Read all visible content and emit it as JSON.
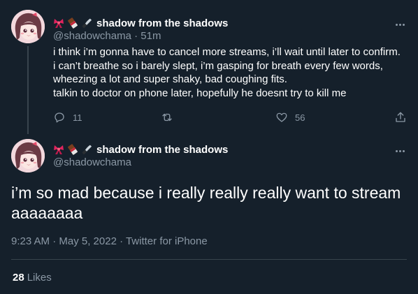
{
  "colors": {
    "background": "#15202b",
    "text_primary": "#ffffff",
    "text_secondary": "#8b98a5",
    "divider": "#38444d"
  },
  "reply_tweet": {
    "author": {
      "display_name": "shadow from the shadows",
      "name_emojis": [
        "ribbon-icon",
        "chocolate-bar-icon",
        "kitchen-knife-icon"
      ],
      "handle": "@shadowchama",
      "time": "· 51m"
    },
    "text_lines": [
      "i think i’m gonna have to cancel more streams, i’ll wait until later to confirm.",
      "i can’t breathe so i barely slept, i’m gasping for breath every few words,",
      "wheezing a lot and super shaky, bad coughing fits.",
      "talkin to doctor on phone later, hopefully he doesnt try to kill me"
    ],
    "actions": {
      "reply_count": "11",
      "retweet_count": "",
      "like_count": "56"
    }
  },
  "main_tweet": {
    "author": {
      "display_name": "shadow from the shadows",
      "name_emojis": [
        "ribbon-icon",
        "chocolate-bar-icon",
        "kitchen-knife-icon"
      ],
      "handle": "@shadowchama"
    },
    "text": "i’m so mad because i really really really want to stream aaaaaaaa",
    "timestamp": "9:23 AM · May 5, 2022 · Twitter for iPhone",
    "likes_count": "28",
    "likes_label": "Likes"
  }
}
